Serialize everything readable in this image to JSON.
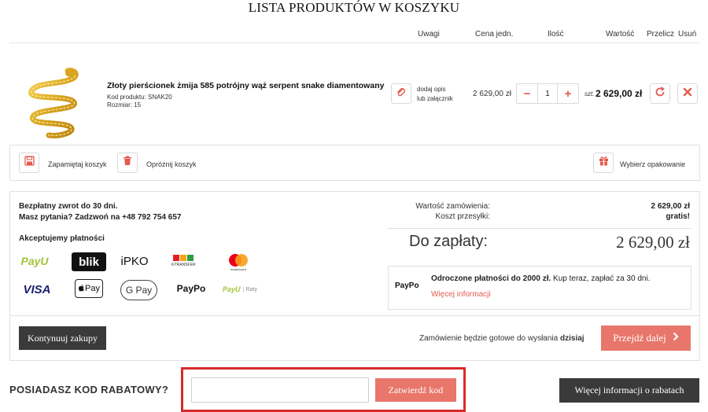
{
  "page": {
    "title": "LISTA PRODUKTÓW W KOSZYKU"
  },
  "columns": {
    "notes": "Uwagi",
    "unit_price": "Cena jedn.",
    "quantity": "Ilość",
    "value": "Wartość",
    "recalc": "Przelicz",
    "remove": "Usuń"
  },
  "product": {
    "name": "Złoty pierścionek żmija 585 potrójny wąż serpent snake diamentowany",
    "code": "Kod produktu: SNAK20",
    "size": "Rozmiar: 15",
    "attach_line1": "dodaj opis",
    "attach_line2": "lub załącznik",
    "unit_price": "2 629,00 zł",
    "quantity": "1",
    "total_prefix": "szt.",
    "total": "2 629,00 zł"
  },
  "actions": {
    "save_cart": "Zapamiętaj koszyk",
    "empty_cart": "Opróżnij koszyk",
    "choose_packaging": "Wybierz opakowanie"
  },
  "info": {
    "free_return": "Bezpłatny zwrot do 30 dni.",
    "questions": "Masz pytania? Zadzwoń na +48 792 754 657",
    "payments_heading": "Akceptujemy płatności"
  },
  "payment_logos": {
    "payu": "PayU",
    "blik": "blik",
    "ipko": "iPKO",
    "mbank": "mBank",
    "mbank_sub": "mTRANSFER",
    "mastercard": "mastercard",
    "visa": "VISA",
    "applepay": "Pay",
    "googlepay": "G Pay",
    "paypo": "PayPo",
    "payu_raty": "PayU",
    "raty": "Raty"
  },
  "summary": {
    "order_value_label": "Wartość zamówienia:",
    "order_value": "2 629,00 zł",
    "shipping_label": "Koszt przesyłki:",
    "shipping": "gratis!",
    "to_pay_label": "Do zapłaty:",
    "to_pay": "2 629,00 zł"
  },
  "paypo": {
    "logo": "PayPo",
    "bold": "Odroczone płatności do 2000 zł.",
    "rest": " Kup teraz, zapłać za 30 dni.",
    "link": "Więcej informacji"
  },
  "footer": {
    "continue": "Kontynuuj zakupy",
    "ready_text": "Zamówienie będzie gotowe do wysłania ",
    "ready_day": "dzisiaj",
    "next": "Przejdź dalej"
  },
  "coupon": {
    "label": "POSIADASZ KOD RABATOWY?",
    "input_value": "",
    "submit": "Zatwierdź kod",
    "more_info": "Więcej informacji o rabatach"
  },
  "colors": {
    "accent": "#e8766b",
    "accent_dark": "#e35a4f",
    "dark_button": "#3a3a3a",
    "highlight": "#d62b2b"
  }
}
